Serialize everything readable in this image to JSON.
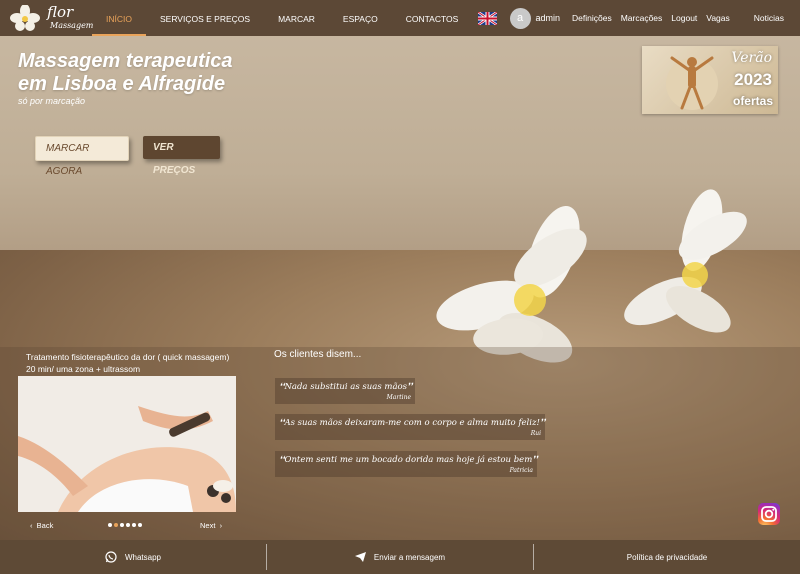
{
  "brand": {
    "name": "flor",
    "subtitle": "Massagem"
  },
  "nav": {
    "items": [
      {
        "label": "INÍCIO",
        "active": true
      },
      {
        "label": "SERVIÇOS E PREÇOS",
        "active": false
      },
      {
        "label": "MARCAR",
        "active": false
      },
      {
        "label": "ESPAÇO",
        "active": false
      },
      {
        "label": "CONTACTOS",
        "active": false
      }
    ]
  },
  "user_nav": {
    "avatar_letter": "a",
    "username": "admin",
    "links": [
      "Definições",
      "Marcações",
      "Logout",
      "Vagas",
      "Noticias"
    ]
  },
  "hero": {
    "title_line1": "Massagem terapeutica",
    "title_line2": "em Lisboa e Alfragide",
    "subtitle": "só por marcação",
    "book_button": "MARCAR AGORA",
    "prices_button": "VER PREÇOS"
  },
  "promo": {
    "title": "Verão",
    "year": "2023",
    "label": "ofertas"
  },
  "service": {
    "title": "Tratamento fisioterapêutico da dor ( quick massagem) 20 min/ uma zona + ultrassom",
    "back_label": "Back",
    "next_label": "Next",
    "slide_count": 6,
    "active_slide": 2
  },
  "testimonials": {
    "heading": "Os clientes disem...",
    "items": [
      {
        "text": "Nada substitui as suas mãos",
        "author": "Martine"
      },
      {
        "text": "As suas mãos deixaram-me com o corpo e alma muito feliz!",
        "author": "Rui"
      },
      {
        "text": "Ontem senti me um bocado dorida mas hoje já estou bem",
        "author": "Patricia"
      }
    ]
  },
  "footer": {
    "whatsapp": "Whatsapp",
    "message": "Enviar a mensagem",
    "privacy": "Política de privacidade"
  },
  "colors": {
    "accent": "#e9a35a",
    "bar": "#5e4a36"
  }
}
